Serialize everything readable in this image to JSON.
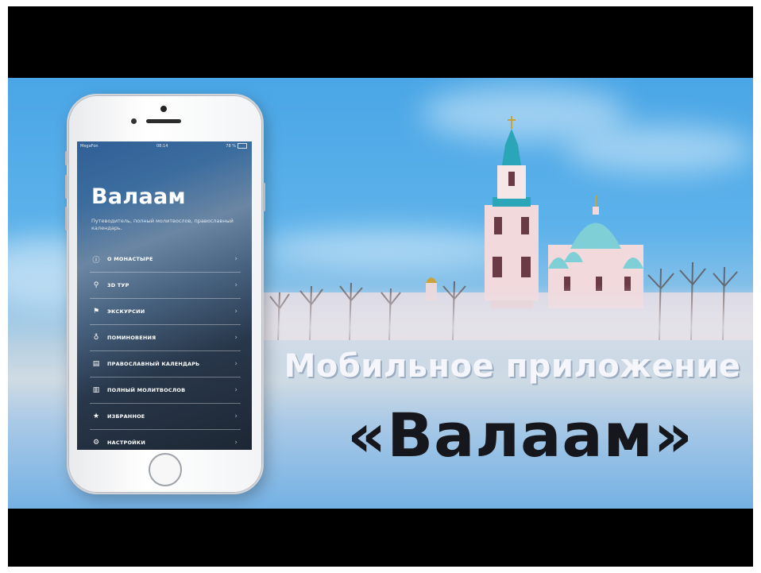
{
  "headline": {
    "line1": "Мобильное приложение",
    "line2": "«Валаам»"
  },
  "phone": {
    "status_bar": {
      "carrier": "MegaFon",
      "time": "08:14",
      "battery": "78 %"
    },
    "app_title": "Валаам",
    "app_subtitle": "Путеводитель, полный молитвослов, православный календарь.",
    "menu": [
      {
        "label": "О монастыре",
        "icon": "info-icon",
        "glyph": "ⓘ"
      },
      {
        "label": "3D тур",
        "icon": "map-pin-icon",
        "glyph": "⚲"
      },
      {
        "label": "Экскурсии",
        "icon": "flag-icon",
        "glyph": "⚑"
      },
      {
        "label": "Поминовения",
        "icon": "candle-icon",
        "glyph": "♁"
      },
      {
        "label": "Православный календарь",
        "icon": "calendar-icon",
        "glyph": "▤"
      },
      {
        "label": "Полный молитвослов",
        "icon": "book-icon",
        "glyph": "▥"
      },
      {
        "label": "Избранное",
        "icon": "star-icon",
        "glyph": "★"
      },
      {
        "label": "Настройки",
        "icon": "gear-icon",
        "glyph": "⚙"
      }
    ],
    "chevron": "›"
  },
  "colors": {
    "sky_top": "#4aa6e6",
    "headline_line1": "#f4f6fb",
    "headline_line2": "#16171c",
    "dome_turquoise": "#2aa6b8",
    "wall_pink": "#f1d9dc"
  }
}
